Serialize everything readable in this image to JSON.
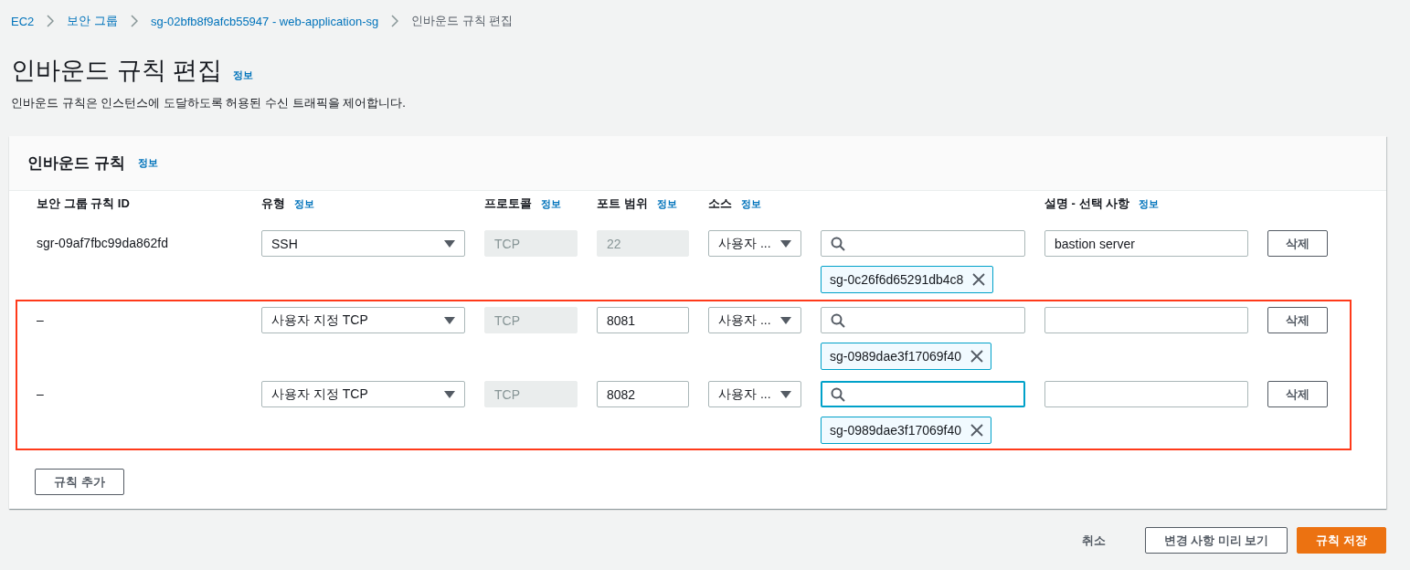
{
  "breadcrumbs": [
    {
      "label": "EC2",
      "link": true
    },
    {
      "label": "보안 그룹",
      "link": true
    },
    {
      "label": "sg-02bfb8f9afcb55947 - web-application-sg",
      "link": true
    },
    {
      "label": "인바운드 규칙 편집",
      "link": false
    }
  ],
  "page_title": "인바운드 규칙 편집",
  "page_title_info": "정보",
  "description": "인바운드 규칙은 인스턴스에 도달하도록 허용된 수신 트래픽을 제어합니다.",
  "panel": {
    "title": "인바운드 규칙",
    "info": "정보",
    "columns": [
      {
        "label": "보안 그룹 규칙 ID"
      },
      {
        "label": "유형",
        "info": "정보"
      },
      {
        "label": "프로토콜",
        "info": "정보"
      },
      {
        "label": "포트 범위",
        "info": "정보"
      },
      {
        "label": "소스",
        "info": "정보"
      },
      {
        "label": "설명 - 선택 사항",
        "info": "정보"
      }
    ],
    "rules": [
      {
        "id": "sgr-09af7fbc99da862fd",
        "type": "SSH",
        "protocol": "TCP",
        "port": "22",
        "port_disabled": true,
        "source": "사용자 ...",
        "search_focused": false,
        "source_tag": "sg-0c26f6d65291db4c8",
        "description": "bastion server",
        "delete": "삭제",
        "highlighted": false
      },
      {
        "id": "–",
        "type": "사용자 지정 TCP",
        "protocol": "TCP",
        "port": "8081",
        "port_disabled": false,
        "source": "사용자 ...",
        "search_focused": false,
        "source_tag": "sg-0989dae3f17069f40",
        "delete": "삭제",
        "highlighted": true
      },
      {
        "id": "–",
        "type": "사용자 지정 TCP",
        "protocol": "TCP",
        "port": "8082",
        "port_disabled": false,
        "source": "사용자 ...",
        "search_focused": true,
        "source_tag": "sg-0989dae3f17069f40",
        "delete": "삭제",
        "highlighted": true
      }
    ],
    "add_button": "규칙 추가"
  },
  "footer": {
    "cancel": "취소",
    "preview": "변경 사항 미리 보기",
    "save": "규칙 저장"
  }
}
